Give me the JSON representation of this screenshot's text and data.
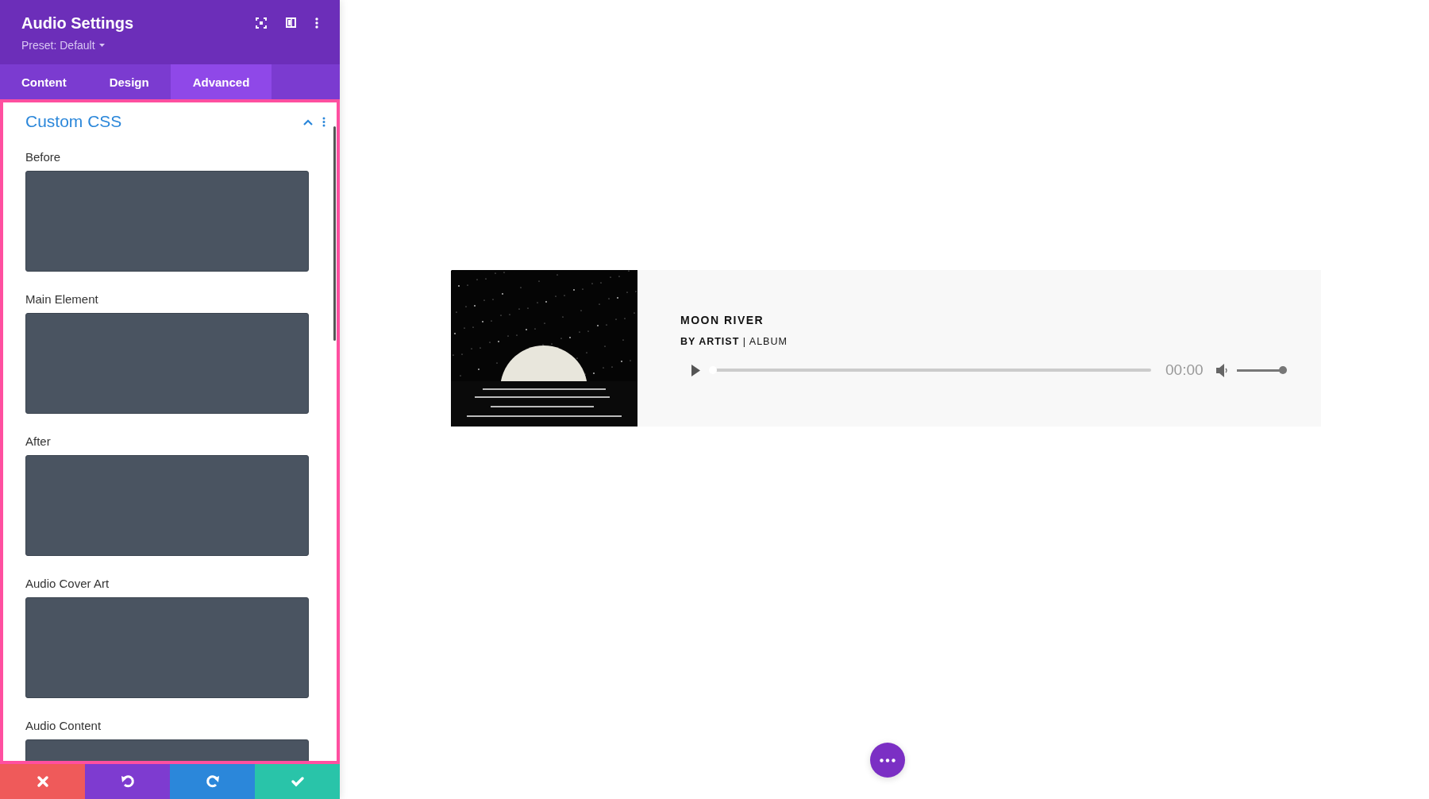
{
  "panel": {
    "title": "Audio Settings",
    "preset": "Preset: Default",
    "tabs": [
      {
        "label": "Content",
        "selected": false
      },
      {
        "label": "Design",
        "selected": false
      },
      {
        "label": "Advanced",
        "selected": true
      }
    ],
    "section": {
      "title": "Custom CSS",
      "expanded": true,
      "fields": [
        {
          "label": "Before"
        },
        {
          "label": "Main Element"
        },
        {
          "label": "After"
        },
        {
          "label": "Audio Cover Art"
        },
        {
          "label": "Audio Content"
        }
      ]
    },
    "actions": [
      {
        "kind": "discard"
      },
      {
        "kind": "undo"
      },
      {
        "kind": "redo"
      },
      {
        "kind": "save"
      }
    ]
  },
  "player": {
    "title": "MOON RIVER",
    "meta": "**BY ARTIST** | ALBUM",
    "time": "00:00",
    "progress": {
      "level": 0
    },
    "volume": {
      "level": 1
    }
  }
}
